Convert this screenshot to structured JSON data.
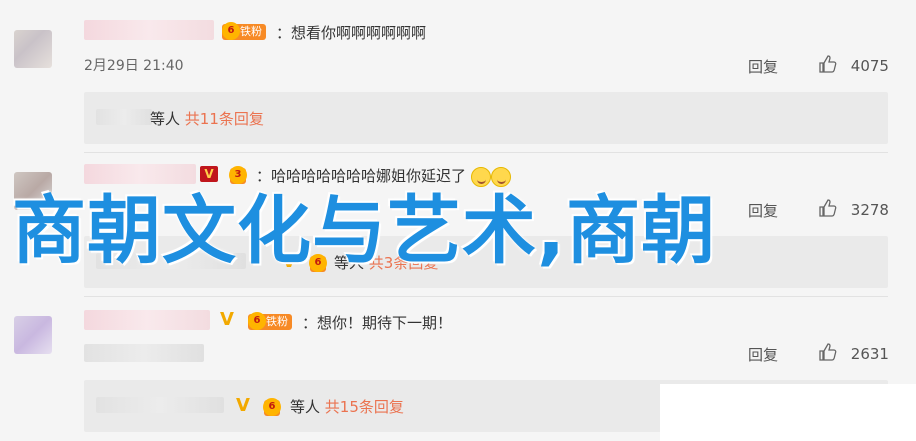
{
  "comments": [
    {
      "text": "：想看你啊啊啊啊啊啊",
      "fan_label": "铁粉",
      "time": "2月29日 21:40",
      "reply_label": "回复",
      "likes": "4075",
      "sub": {
        "suffix": "等人",
        "link": "共11条回复"
      }
    },
    {
      "text": "：哈哈哈哈哈哈哈娜姐你延迟了",
      "reply_label": "回复",
      "likes": "3278",
      "sub": {
        "suffix": "等人",
        "link": "共3条回复"
      }
    },
    {
      "text": "：想你！期待下一期！",
      "fan_label": "铁粉",
      "reply_label": "回复",
      "likes": "2631",
      "sub": {
        "suffix": "等人",
        "link": "共15条回复"
      }
    }
  ],
  "overlay_title": "商朝文化与艺术,商朝",
  "colors": {
    "link": "#eb7350",
    "overlay": "#1e8fe0",
    "fan_badge": "#f78a25"
  },
  "icons": [
    "like-icon",
    "verified-v-icon",
    "fan-badge-icon",
    "laugh-emoji-icon"
  ]
}
